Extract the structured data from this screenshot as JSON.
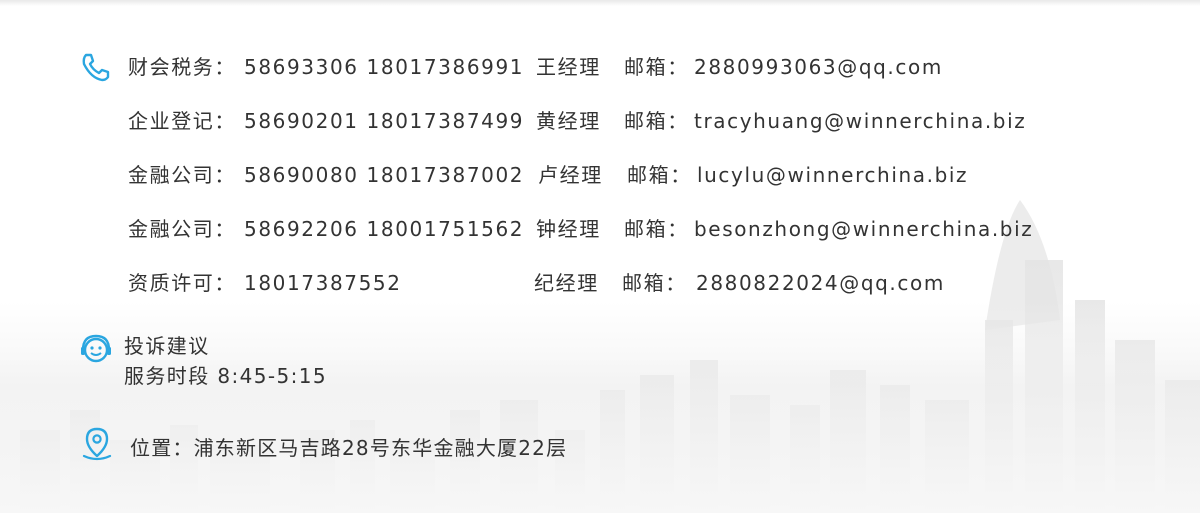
{
  "contacts": [
    {
      "label": "财会税务：",
      "numbers": "58693306 18017386991",
      "manager": "王经理",
      "email_label": "邮箱：",
      "email": "2880993063@qq.com"
    },
    {
      "label": "企业登记：",
      "numbers": "58690201 18017387499",
      "manager": "黄经理",
      "email_label": "邮箱：",
      "email": "tracyhuang@winnerchina.biz"
    },
    {
      "label": "金融公司：",
      "numbers": "58690080 18017387002",
      "manager": "卢经理",
      "email_label": "邮箱：",
      "email": "lucylu@winnerchina.biz"
    },
    {
      "label": "金融公司：",
      "numbers": "58692206 18001751562",
      "manager": "钟经理",
      "email_label": "邮箱：",
      "email": "besonzhong@winnerchina.biz"
    },
    {
      "label": "资质许可：",
      "numbers": "18017387552",
      "manager": "纪经理",
      "email_label": "邮箱：",
      "email": "2880822024@qq.com"
    }
  ],
  "complaint": {
    "title": "投诉建议",
    "hours": "服务时段  8:45-5:15"
  },
  "location": {
    "text": "位置：浦东新区马吉路28号东华金融大厦22层"
  },
  "icons": {
    "phone": "phone-icon",
    "smiley": "smiley-icon",
    "location": "location-pin-icon"
  },
  "colors": {
    "icon_blue": "#2aa6e0",
    "text": "#333333"
  }
}
